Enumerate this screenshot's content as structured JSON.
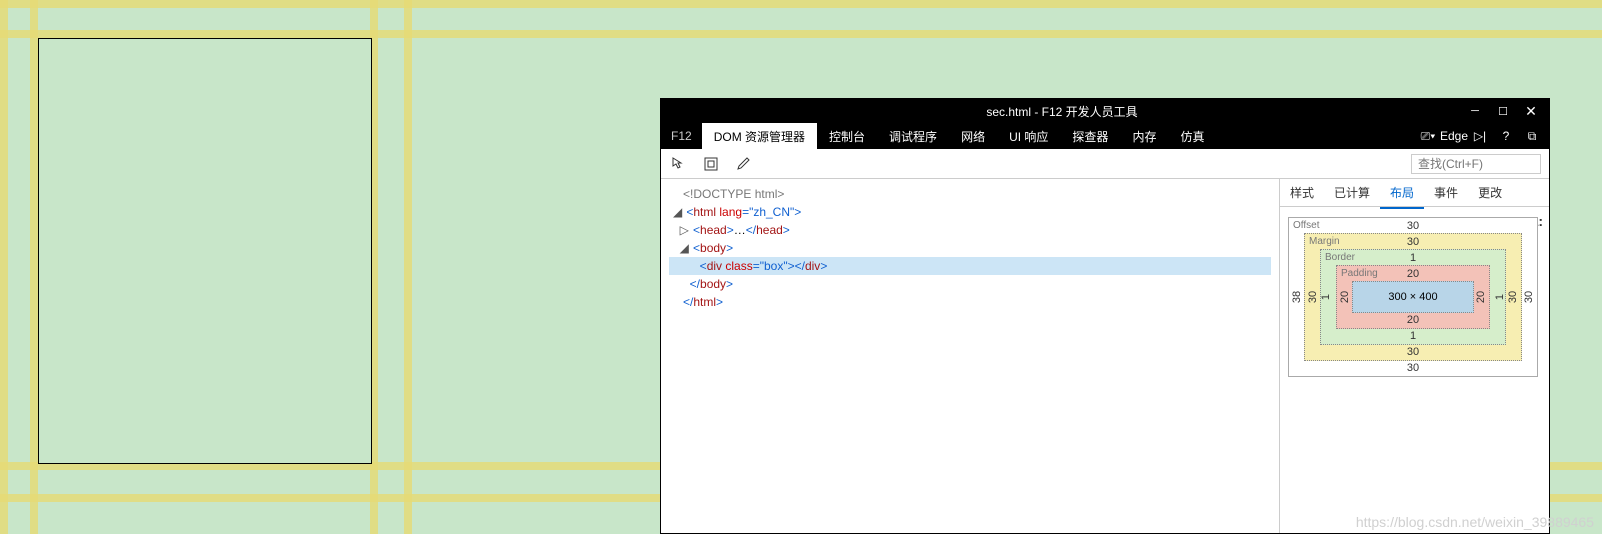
{
  "window": {
    "title": "sec.html - F12 开发人员工具"
  },
  "menubar": {
    "f12": "F12",
    "tabs": [
      {
        "label": "DOM 资源管理器",
        "active": true
      },
      {
        "label": "控制台",
        "active": false
      },
      {
        "label": "调试程序",
        "active": false
      },
      {
        "label": "网络",
        "active": false
      },
      {
        "label": "UI 响应",
        "active": false
      },
      {
        "label": "探查器",
        "active": false
      },
      {
        "label": "内存",
        "active": false
      },
      {
        "label": "仿真",
        "active": false
      }
    ],
    "edge_label": "Edge"
  },
  "toolbar": {
    "search_placeholder": "查找(Ctrl+F)"
  },
  "dom": {
    "doctype": "<!DOCTYPE html>",
    "html_open": "<html lang=\"zh_CN\">",
    "head": "<head>…</head>",
    "body_open": "<body>",
    "div_box": "<div class=\"box\"></div>",
    "body_close": "</body>",
    "html_close": "</html>"
  },
  "side": {
    "tabs": [
      {
        "label": "样式",
        "active": false
      },
      {
        "label": "已计算",
        "active": false
      },
      {
        "label": "布局",
        "active": true
      },
      {
        "label": "事件",
        "active": false
      },
      {
        "label": "更改",
        "active": false
      }
    ],
    "layout": {
      "offset": {
        "label": "Offset",
        "top": "30",
        "bottom": "30",
        "left": "38",
        "right": "30"
      },
      "margin": {
        "label": "Margin",
        "top": "30",
        "bottom": "30",
        "left": "30",
        "right": "30"
      },
      "border": {
        "label": "Border",
        "top": "1",
        "bottom": "1",
        "left": "1",
        "right": "1"
      },
      "padding": {
        "label": "Padding",
        "top": "20",
        "bottom": "20",
        "left": "20",
        "right": "20"
      },
      "content": "300 × 400",
      "a_icon": "a:"
    }
  },
  "watermark": "https://blog.csdn.net/weixin_39889465"
}
